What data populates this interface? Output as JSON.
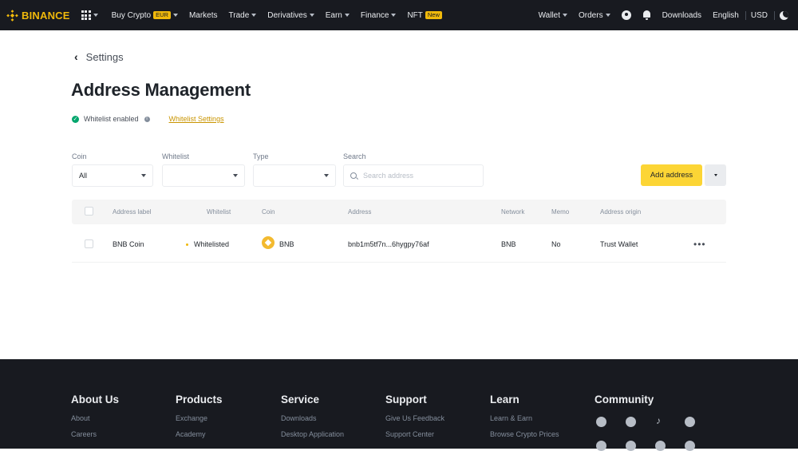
{
  "nav": {
    "logo": "BINANCE",
    "items": [
      {
        "label": "Buy Crypto",
        "badge": "EUR"
      },
      {
        "label": "Markets"
      },
      {
        "label": "Trade"
      },
      {
        "label": "Derivatives"
      },
      {
        "label": "Earn"
      },
      {
        "label": "Finance"
      },
      {
        "label": "NFT",
        "badge": "New"
      }
    ],
    "right": {
      "wallet": "Wallet",
      "orders": "Orders",
      "downloads": "Downloads",
      "language": "English",
      "currency": "USD"
    }
  },
  "page": {
    "back_label": "Settings",
    "title": "Address Management",
    "whitelist_status": "Whitelist enabled",
    "whitelist_settings": "Whitelist Settings"
  },
  "filters": {
    "coin_label": "Coin",
    "coin_value": "All",
    "whitelist_label": "Whitelist",
    "whitelist_value": "",
    "type_label": "Type",
    "type_value": "",
    "search_label": "Search",
    "search_placeholder": "Search address",
    "add_button": "Add address"
  },
  "table": {
    "headers": [
      "Address label",
      "Whitelist",
      "Coin",
      "Address",
      "Network",
      "Memo",
      "Address origin"
    ],
    "rows": [
      {
        "label": "BNB Coin",
        "whitelist": "Whitelisted",
        "coin": "BNB",
        "address": "bnb1m5tf7n...6hygpy76af",
        "network": "BNB",
        "memo": "No",
        "origin": "Trust Wallet"
      }
    ]
  },
  "footer": {
    "columns": [
      {
        "title": "About Us",
        "links": [
          "About",
          "Careers"
        ]
      },
      {
        "title": "Products",
        "links": [
          "Exchange",
          "Academy"
        ]
      },
      {
        "title": "Service",
        "links": [
          "Downloads",
          "Desktop Application"
        ]
      },
      {
        "title": "Support",
        "links": [
          "Give Us Feedback",
          "Support Center"
        ]
      },
      {
        "title": "Learn",
        "links": [
          "Learn & Earn",
          "Browse Crypto Prices"
        ]
      },
      {
        "title": "Community",
        "links": []
      }
    ],
    "social_icons": [
      "discord-icon",
      "telegram-icon",
      "tiktok-icon",
      "facebook-icon",
      "twitter-icon",
      "reddit-icon",
      "instagram-icon",
      "coinmarketcap-icon"
    ]
  },
  "colors": {
    "brand": "#f0b90b",
    "button": "#fcd535",
    "nav_bg": "#181a20",
    "success": "#03a66d",
    "link": "#c99400"
  }
}
